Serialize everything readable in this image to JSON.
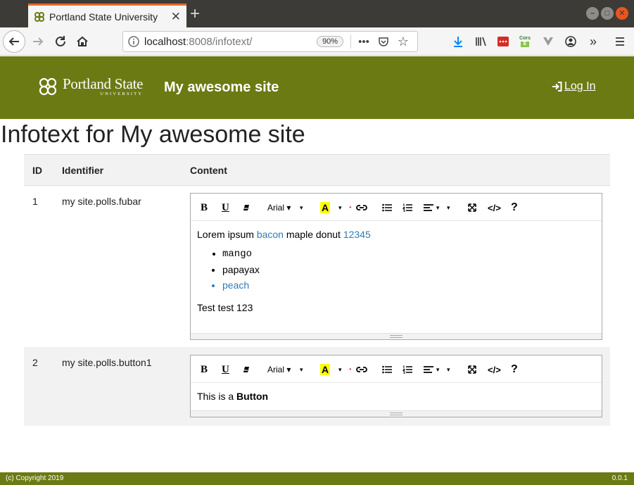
{
  "browser": {
    "tab_title": "Portland State University",
    "url_host": "localhost",
    "url_port_path": ":8008/infotext/",
    "zoom": "90%",
    "ext_cors_line1": "Cors",
    "ext_cors_line2": "E"
  },
  "header": {
    "logo_main": "Portland State",
    "logo_sub": "UNIVERSITY",
    "site_name": "My awesome site",
    "login_label": "Log In"
  },
  "page": {
    "title": "Infotext for My awesome site"
  },
  "table": {
    "col_id": "ID",
    "col_identifier": "Identifier",
    "col_content": "Content",
    "rows": [
      {
        "id": "1",
        "identifier": "my site.polls.fubar",
        "content": {
          "lead": "Lorem ipsum ",
          "link1": "bacon",
          "mid": " maple donut ",
          "link2": "12345",
          "list": [
            "mango",
            "papayax",
            "peach"
          ],
          "tail": "Test test 123"
        }
      },
      {
        "id": "2",
        "identifier": "my site.polls.button1",
        "content": {
          "lead": "This is a ",
          "bold": "Button"
        }
      }
    ]
  },
  "toolbar": {
    "bold": "B",
    "underline": "U",
    "font": "Arial",
    "color_letter": "A",
    "code": "</>",
    "help": "?"
  },
  "footer": {
    "copyright": "(c) Copyright 2019",
    "version": "0.0.1"
  },
  "colors": {
    "brand": "#6c7a13",
    "link": "#337ab7",
    "tab_accent": "#e76b2c"
  }
}
